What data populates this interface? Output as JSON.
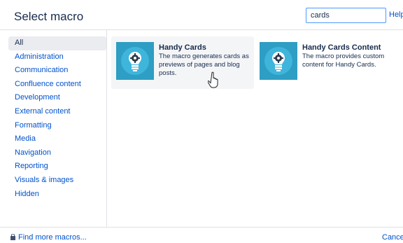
{
  "dialog": {
    "title": "Select macro"
  },
  "search": {
    "value": "cards",
    "help_label": "Help"
  },
  "categories": [
    {
      "label": "All",
      "active": true
    },
    {
      "label": "Administration"
    },
    {
      "label": "Communication"
    },
    {
      "label": "Confluence content"
    },
    {
      "label": "Development"
    },
    {
      "label": "External content"
    },
    {
      "label": "Formatting"
    },
    {
      "label": "Media"
    },
    {
      "label": "Navigation"
    },
    {
      "label": "Reporting"
    },
    {
      "label": "Visuals & images"
    },
    {
      "label": "Hidden"
    }
  ],
  "macros": [
    {
      "name": "Handy Cards",
      "description": "The macro generates cards as previews of pages and blog posts.",
      "icon": "lightbulb-gear-icon"
    },
    {
      "name": "Handy Cards Content",
      "description": "The macro provides custom content for Handy Cards.",
      "icon": "lightbulb-gear-icon"
    }
  ],
  "footer": {
    "find_more_label": "Find more macros...",
    "cancel_label": "Cancel"
  },
  "colors": {
    "link": "#0052cc",
    "icon_bg": "#2e9ec4",
    "active_bg": "#ebecf0",
    "hover_bg": "#f4f5f7"
  }
}
